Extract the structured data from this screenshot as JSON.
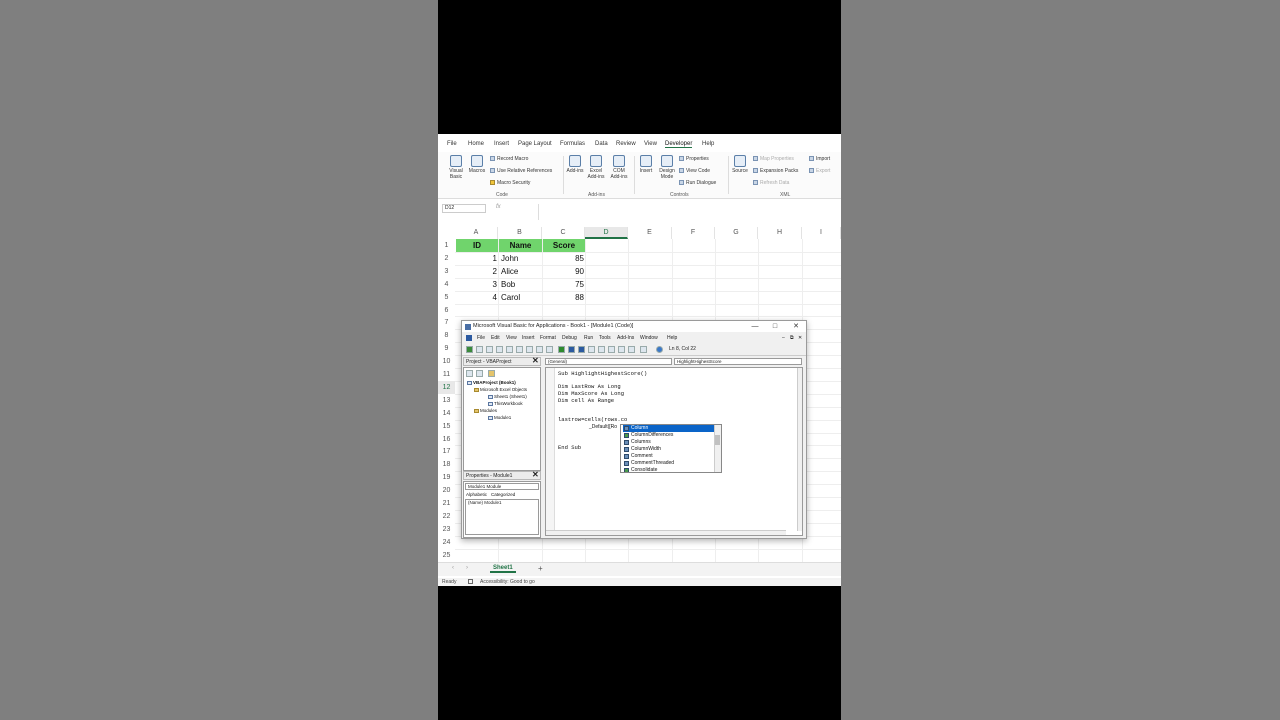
{
  "excel": {
    "menu_tabs": [
      "File",
      "Home",
      "Insert",
      "Page Layout",
      "Formulas",
      "Data",
      "Review",
      "View",
      "Developer",
      "Help"
    ],
    "active_tab": "Developer",
    "ribbon": {
      "visual_basic": "Visual Basic",
      "macros": "Macros",
      "record_macro": "Record Macro",
      "use_relative_refs": "Use Relative References",
      "macro_security": "Macro Security",
      "group_code": "Code",
      "addins": "Add-ins",
      "excel_addins": "Excel Add-ins",
      "com_addins": "COM Add-ins",
      "group_addins": "Add-ins",
      "insert": "Insert",
      "design_mode": "Design Mode",
      "properties": "Properties",
      "view_code": "View Code",
      "run_dialog": "Run Dialogue",
      "group_controls": "Controls",
      "source": "Source",
      "map_properties": "Map Properties",
      "expansion_packs": "Expansion Packs",
      "refresh_data": "Refresh Data",
      "import": "Import",
      "export": "Export",
      "group_xml": "XML"
    },
    "name_box": "D12",
    "fx": "fx",
    "columns": [
      "A",
      "B",
      "C",
      "D",
      "E",
      "F",
      "G",
      "H",
      "I"
    ],
    "rows": [
      "1",
      "2",
      "3",
      "4",
      "5",
      "6",
      "7",
      "8",
      "9",
      "10",
      "11",
      "12",
      "13",
      "14",
      "15",
      "16",
      "17",
      "18",
      "19",
      "20",
      "21",
      "22",
      "23",
      "24",
      "25"
    ],
    "table": {
      "headers": [
        "ID",
        "Name",
        "Score"
      ],
      "data": [
        [
          "1",
          "John",
          "85"
        ],
        [
          "2",
          "Alice",
          "90"
        ],
        [
          "3",
          "Bob",
          "75"
        ],
        [
          "4",
          "Carol",
          "88"
        ]
      ]
    },
    "sheet_tab": "Sheet1",
    "add_sheet": "+",
    "status_ready": "Ready",
    "status_accessibility": "Accessibility: Good to go"
  },
  "vba": {
    "title": "Microsoft Visual Basic for Applications - Book1 - [Module1 (Code)]",
    "menu": [
      "File",
      "Edit",
      "View",
      "Insert",
      "Format",
      "Debug",
      "Run",
      "Tools",
      "Add-Ins",
      "Window",
      "Help"
    ],
    "cursor_pos": "Ln 8, Col 22",
    "project_title": "Project - VBAProject",
    "tree": {
      "root": "VBAProject (Book1)",
      "excel_objects": "Microsoft Excel Objects",
      "sheet1": "Sheet1 (Sheet1)",
      "thisworkbook": "ThisWorkbook",
      "modules": "Modules",
      "module1": "Module1"
    },
    "props_title": "Properties - Module1",
    "props_combo": "Module1 Module",
    "props_tab_alpha": "Alphabetic",
    "props_tab_cat": "Categorized",
    "props_row": "(Name)  Module1",
    "combo_left": "(General)",
    "combo_right": "HighlightHighestScore",
    "code_lines": [
      "Sub HighlightHighestScore()",
      "",
      "Dim LastRow As Long",
      "Dim MaxScore As Long",
      "Dim cell As Range",
      "",
      "",
      "lastrow=cells(rows.co",
      "",
      "",
      "",
      "End Sub"
    ],
    "tooltip": "_Default([Ro",
    "autocomplete": [
      "Column",
      "ColumnDifferences",
      "Columns",
      "ColumnWidth",
      "Comment",
      "CommentThreaded",
      "Consolidate"
    ],
    "autocomplete_selected": 0
  }
}
